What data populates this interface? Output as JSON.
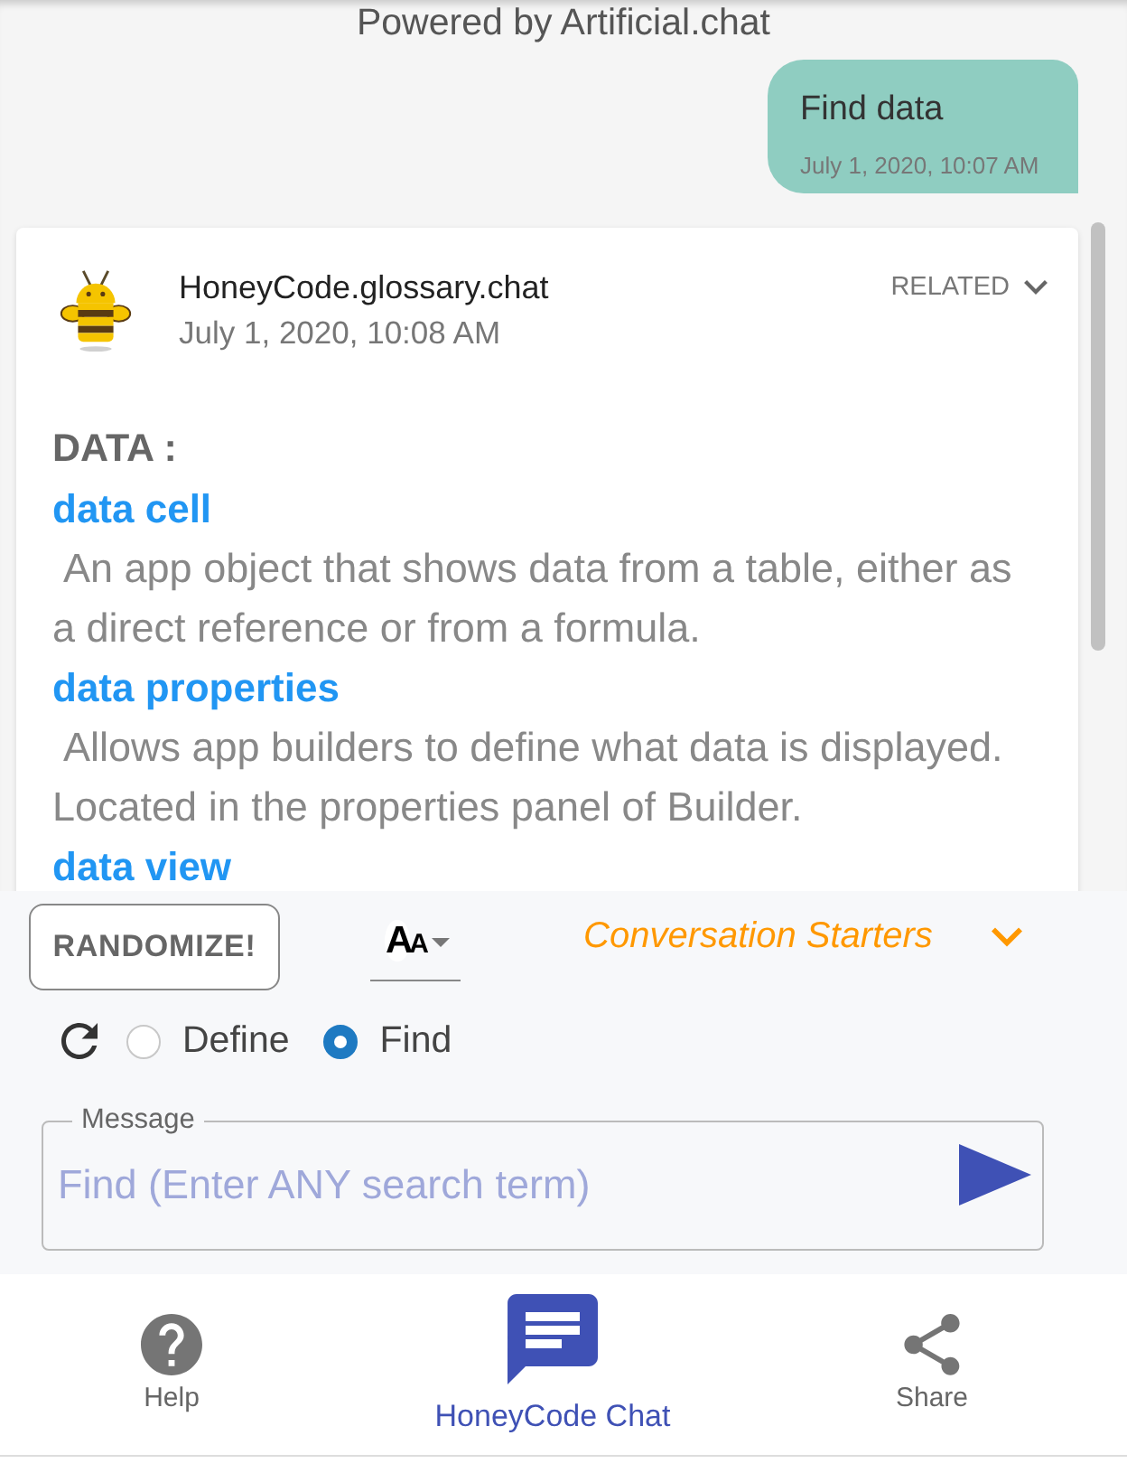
{
  "header": {
    "powered_by": "Powered by Artificial.chat"
  },
  "messages": [
    {
      "kind": "user",
      "text": "Find data",
      "time": "July 1, 2020, 10:07 AM"
    },
    {
      "kind": "bot",
      "sender": "HoneyCode.glossary.chat",
      "time": "July 1, 2020, 10:08 AM",
      "related": "RELATED",
      "heading": "DATA :",
      "entries": [
        {
          "term": "data cell",
          "definition": "An app object that shows data from a table, either as a direct reference or from a formula."
        },
        {
          "term": "data properties",
          "definition": "Allows app builders to define what data is displayed. Located in the properties panel of Builder."
        },
        {
          "term": "data view"
        }
      ]
    }
  ],
  "controls": {
    "randomize": "RANDOMIZE!",
    "font_size": "AA",
    "starters": "Conversation Starters",
    "modes": [
      {
        "label": "Define",
        "selected": false
      },
      {
        "label": "Find",
        "selected": true
      }
    ]
  },
  "message_field": {
    "label": "Message",
    "placeholder": "Find (Enter ANY search term)"
  },
  "nav": [
    {
      "kind": "help",
      "label": "Help",
      "selected": false
    },
    {
      "kind": "chat",
      "label": "HoneyCode Chat",
      "selected": true
    },
    {
      "kind": "share",
      "label": "Share",
      "selected": false
    }
  ]
}
